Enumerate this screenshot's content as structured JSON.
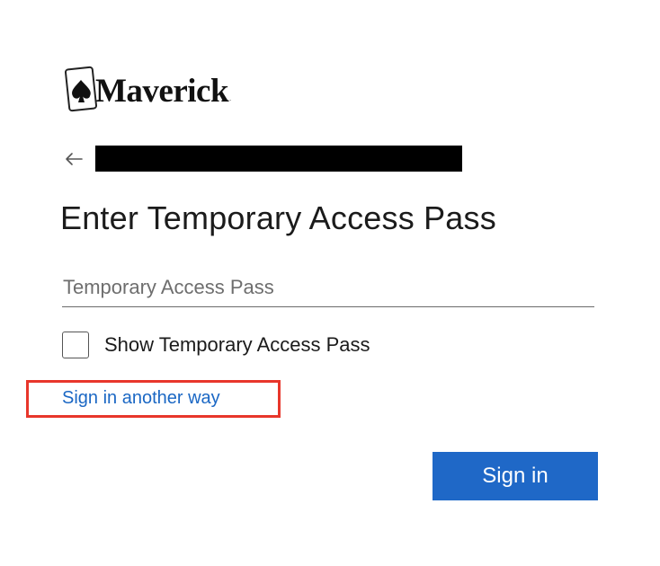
{
  "brand": {
    "name": "Maverick",
    "trademark": "."
  },
  "header": {
    "back_icon": "arrow-left-icon",
    "identity_redacted": true
  },
  "page": {
    "title": "Enter Temporary Access Pass"
  },
  "pass_field": {
    "placeholder": "Temporary Access Pass",
    "value": ""
  },
  "show_pass": {
    "label": "Show Temporary Access Pass",
    "checked": false
  },
  "links": {
    "sign_in_another_way": "Sign in another way"
  },
  "actions": {
    "sign_in_label": "Sign in"
  },
  "colors": {
    "primary_button": "#1f68c7",
    "link": "#1a67c4",
    "highlight": "#e8362b"
  }
}
